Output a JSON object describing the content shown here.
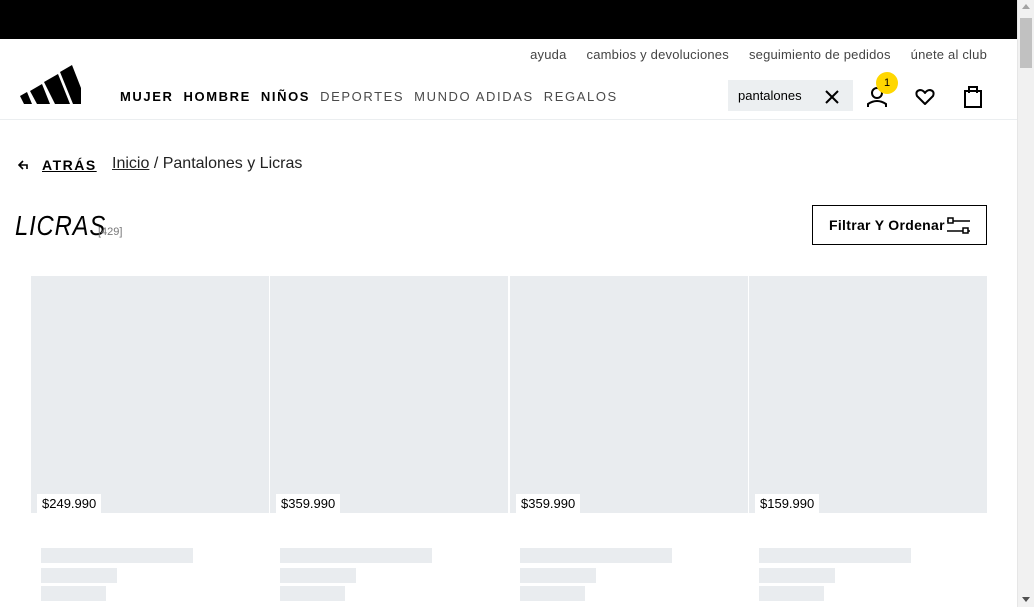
{
  "utility_links": [
    "ayuda",
    "cambios y devoluciones",
    "seguimiento de pedidos",
    "únete al club"
  ],
  "nav": {
    "primary": [
      "MUJER",
      "HOMBRE",
      "NIÑOS"
    ],
    "secondary": [
      "DEPORTES",
      "MUNDO ADIDAS",
      "REGALOS"
    ]
  },
  "search": {
    "value": "pantalones"
  },
  "account": {
    "badge_count": "1"
  },
  "back_label": "ATRÁS",
  "breadcrumb": {
    "home": "Inicio",
    "separator": "/",
    "current": "Pantalones y Licras"
  },
  "page": {
    "title": "LICRAS",
    "count": "[429]"
  },
  "filter_button": "Filtrar Y Ordenar",
  "products": [
    {
      "price": "$249.990"
    },
    {
      "price": "$359.990"
    },
    {
      "price": "$359.990"
    },
    {
      "price": "$159.990"
    }
  ],
  "colors": {
    "topbar": "#000000",
    "badge": "#ffd700",
    "placeholder": "#e9ecef"
  }
}
